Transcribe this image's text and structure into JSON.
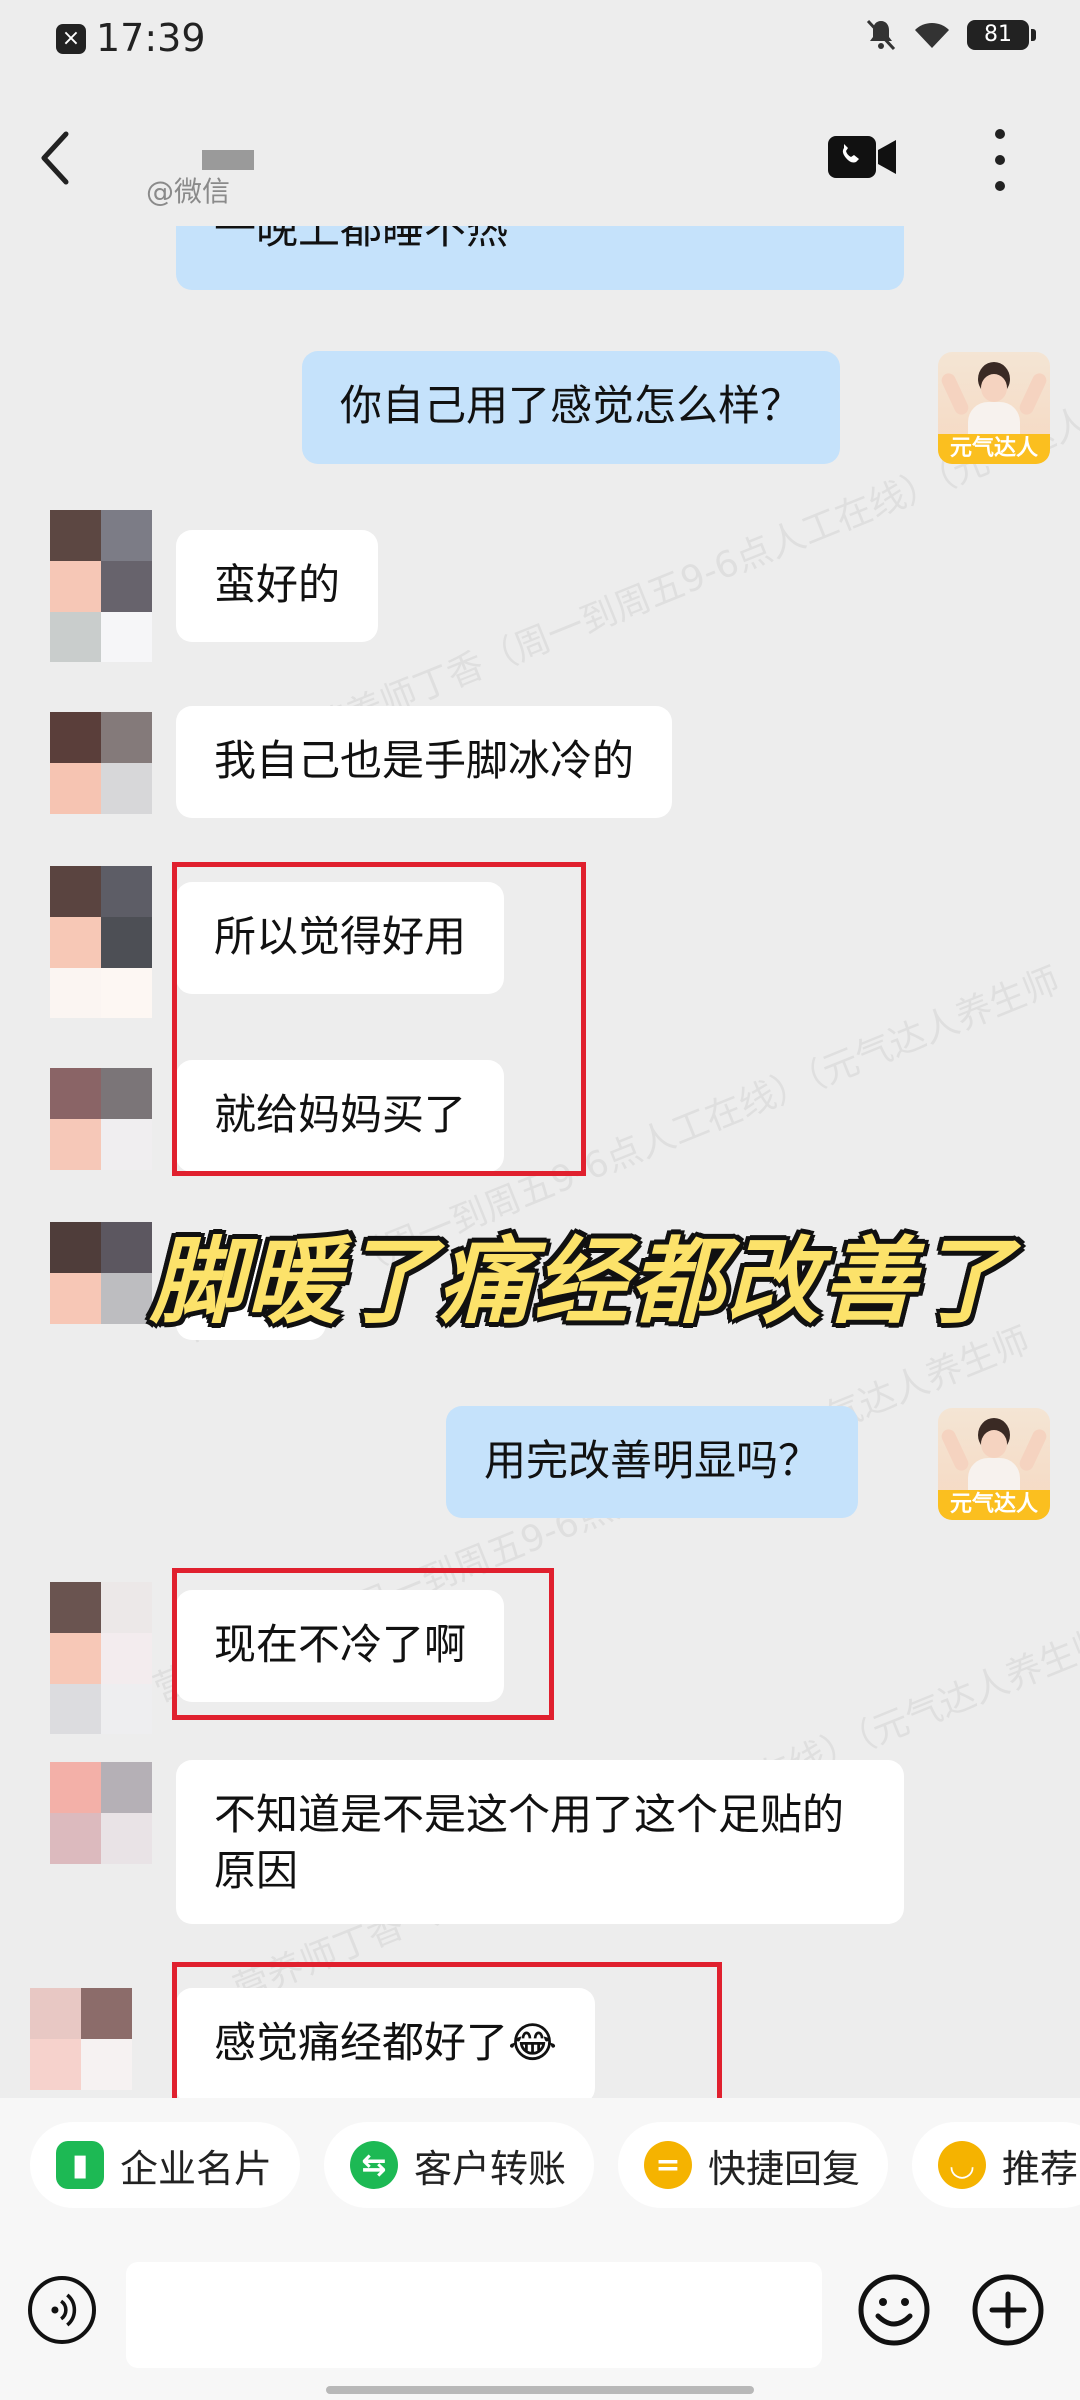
{
  "status_bar": {
    "time": "17:39",
    "battery": "81"
  },
  "header": {
    "contact_subtitle": "@微信"
  },
  "overlay_caption": "脚暖了痛经都改善了",
  "self_avatar_label": "元气达人",
  "watermark_text": "营养师丁香（周一到周五9-6点人工在线）（元气达人养生师",
  "messages": [
    {
      "dir": "out",
      "text": "一晚上都睡不热"
    },
    {
      "dir": "out",
      "text": "你自己用了感觉怎么样？"
    },
    {
      "dir": "in",
      "text": "蛮好的"
    },
    {
      "dir": "in",
      "text": "我自己也是手脚冰冷的"
    },
    {
      "dir": "in",
      "text": "所以觉得好用"
    },
    {
      "dir": "in",
      "text": "就给妈妈买了"
    },
    {
      "dir": "out",
      "text": "用完改善明显吗？"
    },
    {
      "dir": "in",
      "text": "现在不冷了啊"
    },
    {
      "dir": "in",
      "text": "不知道是不是这个用了这个足贴的原因"
    },
    {
      "dir": "in",
      "text": "感觉痛经都好了😂"
    }
  ],
  "quick_actions": [
    {
      "label": "企业名片",
      "icon": "business-card-icon",
      "color": "#1db954"
    },
    {
      "label": "客户转账",
      "icon": "transfer-icon",
      "color": "#1db954"
    },
    {
      "label": "快捷回复",
      "icon": "quick-reply-icon",
      "color": "#f5b300"
    },
    {
      "label": "推荐",
      "icon": "recommend-icon",
      "color": "#f5b300"
    }
  ],
  "colors": {
    "incoming_bubble": "#ffffff",
    "outgoing_bubble": "#c5e2fb",
    "highlight": "#e0202e",
    "caption": "#fce26a"
  }
}
